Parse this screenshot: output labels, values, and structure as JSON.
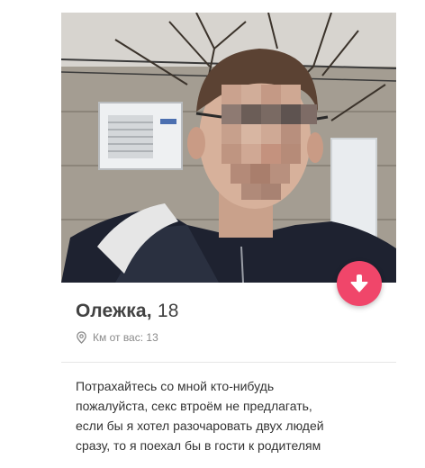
{
  "profile": {
    "name": "Олежка,",
    "age": "18",
    "distance": "Км от вас: 13",
    "bio_lines": [
      "Потрахайтесь со мной кто-нибудь",
      "пожалуйста, секс втроём не предлагать,",
      "если бы я хотел разочаровать двух людей",
      "сразу, то я поехал бы в гости к родителям"
    ]
  },
  "icons": {
    "info_button": "arrow-down-icon",
    "location": "location-pin-icon"
  },
  "colors": {
    "accent": "#f0466a",
    "name_text": "#424242",
    "muted_text": "#8a8a8a",
    "body_text": "#333333"
  }
}
